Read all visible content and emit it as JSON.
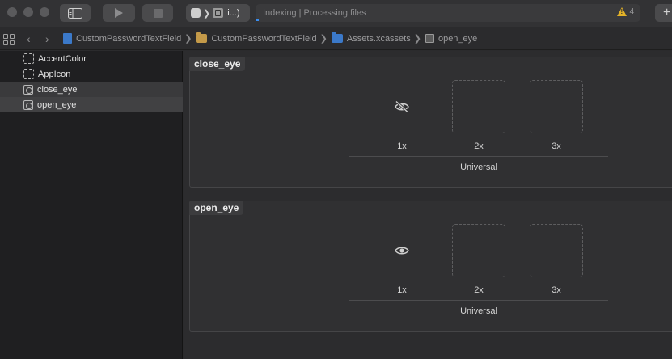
{
  "toolbar": {
    "scheme": {
      "destination": "i...)",
      "separator": "❯"
    },
    "activity": {
      "status": "Indexing | Processing files"
    },
    "warnings": {
      "count": "4"
    },
    "add_label": "+"
  },
  "jumpbar": {
    "separator": "❯",
    "crumbs": [
      "CustomPasswordTextField",
      "CustomPasswordTextField",
      "Assets.xcassets",
      "open_eye"
    ]
  },
  "sidebar": {
    "items": [
      {
        "label": "AccentColor"
      },
      {
        "label": "AppIcon"
      },
      {
        "label": "close_eye"
      },
      {
        "label": "open_eye"
      }
    ]
  },
  "editor": {
    "sets": [
      {
        "title": "close_eye",
        "icon": "eye-slash-icon",
        "scales": [
          "1x",
          "2x",
          "3x"
        ],
        "group": "Universal"
      },
      {
        "title": "open_eye",
        "icon": "eye-icon",
        "scales": [
          "1x",
          "2x",
          "3x"
        ],
        "group": "Universal"
      }
    ]
  },
  "colors": {
    "accent": "#3a8ef0",
    "warning": "#e3b228",
    "project_icon": "#3b79c9",
    "folder_icon": "#c49a49"
  }
}
